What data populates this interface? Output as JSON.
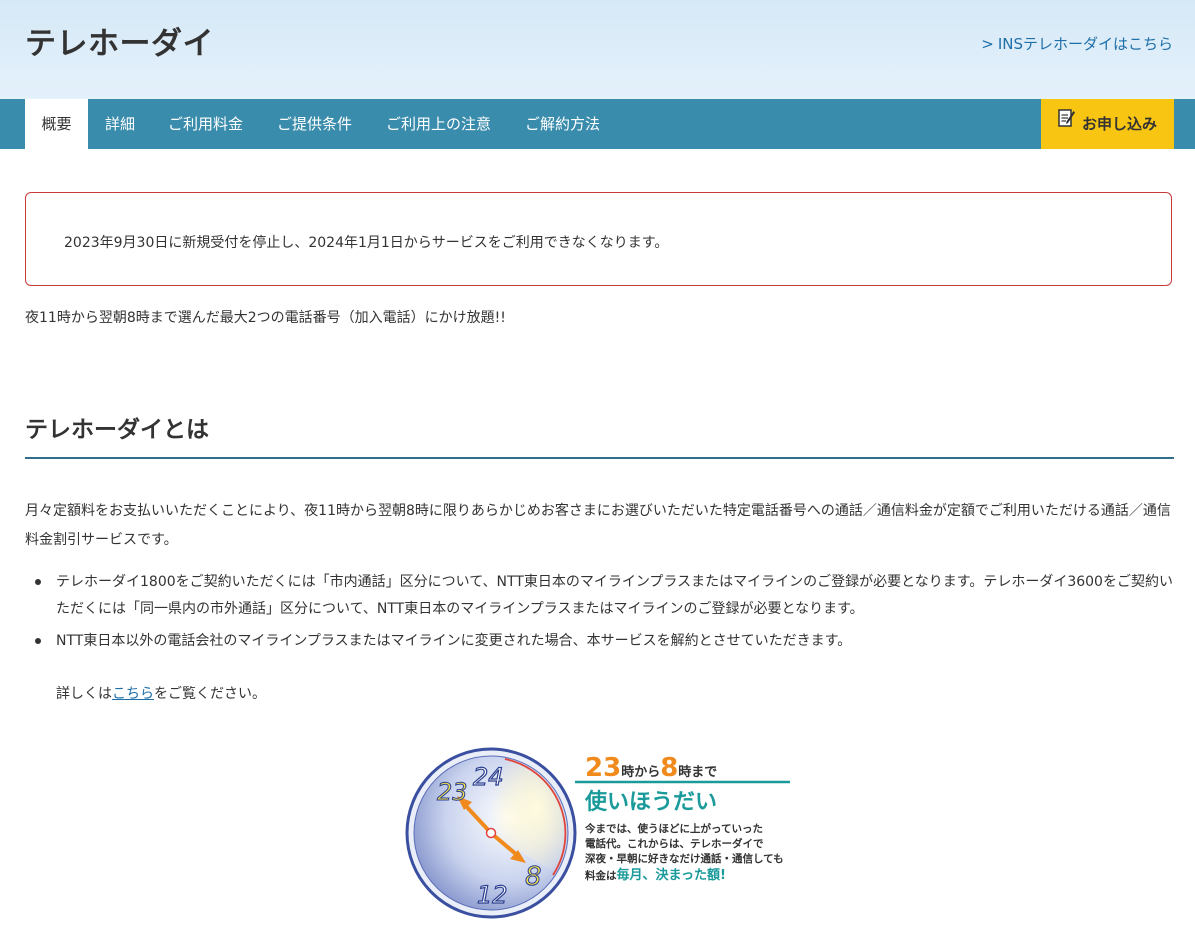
{
  "header": {
    "title": "テレホーダイ",
    "ins_link": "INSテレホーダイはこちら",
    "ins_link_icon": "chevron-right-icon"
  },
  "nav": {
    "tabs": [
      {
        "label": "概要",
        "active": true
      },
      {
        "label": "詳細",
        "active": false
      },
      {
        "label": "ご利用料金",
        "active": false
      },
      {
        "label": "ご提供条件",
        "active": false
      },
      {
        "label": "ご利用上の注意",
        "active": false
      },
      {
        "label": "ご解約方法",
        "active": false
      }
    ],
    "apply_label": "お申し込み",
    "apply_icon": "pen-paper-icon"
  },
  "notice": {
    "text": "2023年9月30日に新規受付を停止し、2024年1月1日からサービスをご利用できなくなります。"
  },
  "lead": "夜11時から翌朝8時まで選んだ最大2つの電話番号（加入電話）にかけ放題!!",
  "section": {
    "title": "テレホーダイとは",
    "description": "月々定額料をお支払いいただくことにより、夜11時から翌朝8時に限りあらかじめお客さまにお選びいただいた特定電話番号への通話／通信料金が定額でご利用いただける通話／通信料金割引サービスです。",
    "bullets": [
      "テレホーダイ1800をご契約いただくには「市内通話」区分について、NTT東日本のマイラインプラスまたはマイラインのご登録が必要となります。テレホーダイ3600をご契約いただくには「同一県内の市外通話」区分について、NTT東日本のマイラインプラスまたはマイラインのご登録が必要となります。",
      "NTT東日本以外の電話会社のマイラインプラスまたはマイラインに変更された場合、本サービスを解約とさせていただきます。"
    ],
    "detail_prefix": "詳しくは",
    "detail_link": "こちら",
    "detail_suffix": "をご覧ください。"
  },
  "promo": {
    "clock_numbers": [
      "23",
      "24",
      "8",
      "12"
    ],
    "headline_start": "23",
    "headline_from": "時から",
    "headline_end": "8",
    "headline_until": "時まで",
    "slogan": "使いほうだい",
    "body_lines": [
      "今までは、使うほどに上がっていった",
      "電話代。これからは、テレホーダイで",
      "深夜・早朝に好きなだけ通話・通信しても"
    ],
    "last_line_prefix": "料金は",
    "last_line_emphasis": "毎月、決まった額!",
    "colors": {
      "orange": "#f08a1c",
      "teal": "#1a9a9a",
      "clock_blue": "#2b3f8f"
    }
  }
}
